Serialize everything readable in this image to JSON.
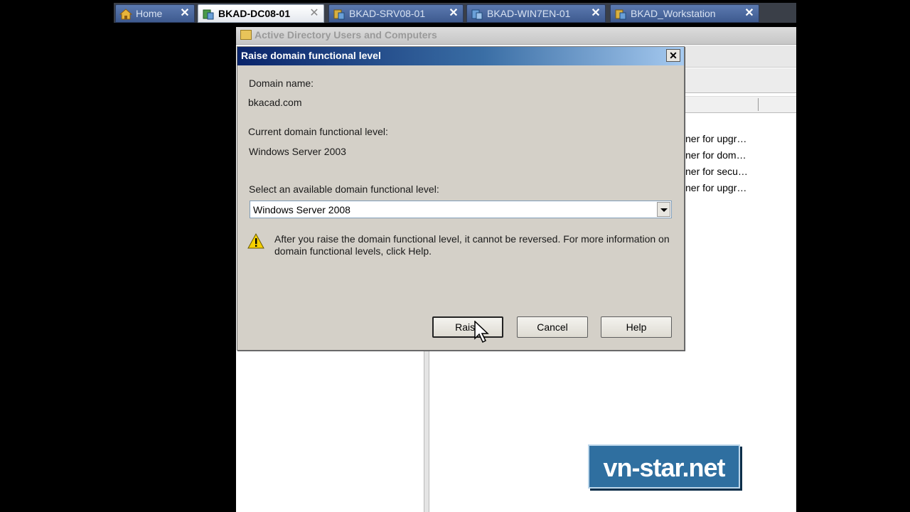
{
  "tabs": [
    {
      "label": "Home",
      "icon": "home-icon"
    },
    {
      "label": "BKAD-DC08-01",
      "icon": "server-icon",
      "active": true
    },
    {
      "label": "BKAD-SRV08-01",
      "icon": "server-icon"
    },
    {
      "label": "BKAD-WIN7EN-01",
      "icon": "server-icon"
    },
    {
      "label": "BKAD_Workstation",
      "icon": "server-icon"
    }
  ],
  "tab_close_glyph": "✕",
  "background_window": {
    "title": "Active Directory Users and Computers",
    "rows": [
      "ner for upgr…",
      "ner for dom…",
      "ner for secu…",
      "ner for upgr…"
    ]
  },
  "dialog": {
    "title": "Raise domain functional level",
    "close_glyph": "✕",
    "domain_name_label": "Domain name:",
    "domain_name_value": "bkacad.com",
    "current_level_label": "Current domain functional level:",
    "current_level_value": "Windows Server 2003",
    "select_label": "Select an available domain functional level:",
    "selected_level": "Windows Server 2008",
    "warning": "After you raise the domain functional level, it cannot be reversed. For more information on domain functional levels, click Help.",
    "buttons": {
      "raise": "Raise",
      "cancel": "Cancel",
      "help": "Help"
    }
  },
  "watermark": "vn-star.net",
  "colors": {
    "title_bar": "#0a246a",
    "dialog_bg": "#d4d0c8",
    "watermark_bg": "#2f6fa0"
  }
}
